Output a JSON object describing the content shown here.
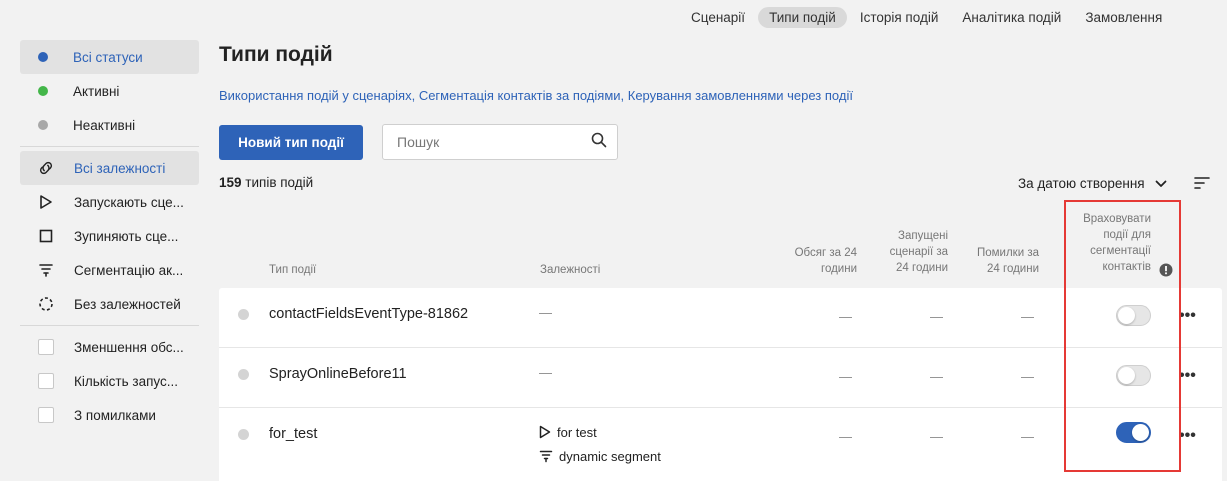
{
  "topnav": {
    "tabs": [
      {
        "label": "Сценарії",
        "active": false
      },
      {
        "label": "Типи подій",
        "active": true
      },
      {
        "label": "Історія подій",
        "active": false
      },
      {
        "label": "Аналітика подій",
        "active": false
      },
      {
        "label": "Замовлення",
        "active": false
      }
    ]
  },
  "sidebar": {
    "status_filters": [
      {
        "label": "Всі статуси",
        "dot_color": "#2e63b8",
        "active": true
      },
      {
        "label": "Активні",
        "dot_color": "#43b649",
        "active": false
      },
      {
        "label": "Неактивні",
        "dot_color": "#a8a8a8",
        "active": false
      }
    ],
    "dependency_filters": [
      {
        "label": "Всі залежності",
        "icon": "link-icon",
        "active": true
      },
      {
        "label": "Запускають сце...",
        "icon": "play-icon",
        "active": false
      },
      {
        "label": "Зупиняють сце...",
        "icon": "stop-icon",
        "active": false
      },
      {
        "label": "Сегментацію ак...",
        "icon": "funnel-icon",
        "active": false
      },
      {
        "label": "Без залежностей",
        "icon": "dashed-loop-icon",
        "active": false
      }
    ],
    "checkbox_filters": [
      {
        "label": "Зменшення обс...",
        "checked": false
      },
      {
        "label": "Кількість запус...",
        "checked": false
      },
      {
        "label": "З помилками",
        "checked": false
      }
    ]
  },
  "main": {
    "title": "Типи подій",
    "help_links": [
      "Використання подій у сценаріях",
      "Сегментація контактів за подіями",
      "Керування замовленнями через події"
    ],
    "link_separator": ", ",
    "new_button_label": "Новий тип події",
    "search_placeholder": "Пошук",
    "count_number": "159",
    "count_suffix": " типів подій",
    "sort_label": "За датою створення"
  },
  "table": {
    "headers": {
      "type": "Тип події",
      "dependencies": "Залежності",
      "volume_line1": "Обсяг за 24",
      "volume_line2": "години",
      "scenarios_line1": "Запущені",
      "scenarios_line2": "сценарії за",
      "scenarios_line3": "24 години",
      "errors_line1": "Помилки за",
      "errors_line2": "24 години",
      "segmentation_line1": "Враховувати",
      "segmentation_line2": "події для",
      "segmentation_line3": "сегментації",
      "segmentation_line4": "контактів"
    },
    "rows": [
      {
        "name": "contactFieldsEventType-81862",
        "deps_dash": "—",
        "volume": "—",
        "scenarios": "—",
        "errors": "—",
        "segmentation": false,
        "deps": []
      },
      {
        "name": "SprayOnlineBefore11",
        "deps_dash": "—",
        "volume": "—",
        "scenarios": "—",
        "errors": "—",
        "segmentation": false,
        "deps": []
      },
      {
        "name": "for_test",
        "deps_dash": "",
        "volume": "—",
        "scenarios": "—",
        "errors": "—",
        "segmentation": true,
        "deps": [
          {
            "icon": "play-icon",
            "label": "for test"
          },
          {
            "icon": "funnel-icon",
            "label": "dynamic segment"
          }
        ]
      }
    ],
    "more_label": "•••"
  },
  "colors": {
    "accent": "#2e63b8",
    "active_dot": "#43b649",
    "inactive_dot": "#a8a8a8",
    "highlight": "#e53935"
  }
}
